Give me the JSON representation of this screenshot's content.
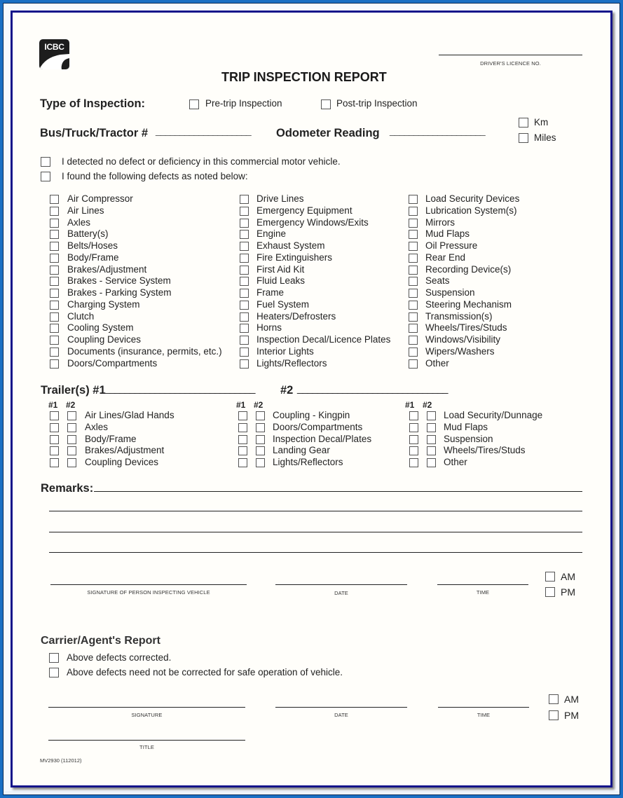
{
  "header": {
    "logo_text": "ICBC",
    "title": "TRIP INSPECTION REPORT",
    "drivers_licence_label": "DRIVER'S LICENCE NO."
  },
  "inspection_type": {
    "label": "Type of Inspection:",
    "options": [
      "Pre-trip Inspection",
      "Post-trip Inspection"
    ]
  },
  "vehicle": {
    "bus_label": "Bus/Truck/Tractor #",
    "bus_blank": "____________________",
    "odometer_label": "Odometer Reading",
    "odometer_blank": "____________________",
    "units": [
      "Km",
      "Miles"
    ]
  },
  "statements": [
    "I detected no defect or deficiency in this commercial motor vehicle.",
    "I found the following defects as noted below:"
  ],
  "defects": {
    "col1": [
      "Air Compressor",
      "Air Lines",
      "Axles",
      "Battery(s)",
      "Belts/Hoses",
      "Body/Frame",
      "Brakes/Adjustment",
      "Brakes - Service System",
      "Brakes - Parking System",
      "Charging System",
      "Clutch",
      "Cooling System",
      "Coupling Devices",
      "Documents (insurance, permits, etc.)",
      "Doors/Compartments"
    ],
    "col2": [
      "Drive Lines",
      "Emergency Equipment",
      "Emergency Windows/Exits",
      "Engine",
      "Exhaust System",
      "Fire Extinguishers",
      "First Aid Kit",
      "Fluid Leaks",
      "Frame",
      "Fuel System",
      "Heaters/Defrosters",
      "Horns",
      "Inspection Decal/Licence Plates",
      "Interior Lights",
      "Lights/Reflectors"
    ],
    "col3": [
      "Load Security Devices",
      "Lubrication System(s)",
      "Mirrors",
      "Mud Flaps",
      "Oil Pressure",
      "Rear End",
      "Recording Device(s)",
      "Seats",
      "Suspension",
      "Steering Mechanism",
      "Transmission(s)",
      "Wheels/Tires/Studs",
      "Windows/Visibility",
      "Wipers/Washers",
      "Other"
    ]
  },
  "trailers": {
    "label1": "Trailer(s) #1",
    "blank1": "______________________________",
    "label2": "#2",
    "blank2": "______________________________",
    "h1": "#1",
    "h2": "#2",
    "col1": [
      "Air Lines/Glad Hands",
      "Axles",
      "Body/Frame",
      "Brakes/Adjustment",
      "Coupling Devices"
    ],
    "col2": [
      "Coupling - Kingpin",
      "Doors/Compartments",
      "Inspection Decal/Plates",
      "Landing Gear",
      "Lights/Reflectors"
    ],
    "col3": [
      "Load Security/Dunnage",
      "Mud Flaps",
      "Suspension",
      "Wheels/Tires/Studs",
      "Other"
    ]
  },
  "remarks": {
    "label": "Remarks:",
    "signature_label": "SIGNATURE OF PERSON INSPECTING VEHICLE",
    "date_label": "DATE",
    "time_label": "TIME",
    "am": "AM",
    "pm": "PM"
  },
  "carrier": {
    "title": "Carrier/Agent's Report",
    "options": [
      "Above defects corrected.",
      "Above defects need not be corrected for safe operation of vehicle."
    ],
    "signature_label": "SIGNATURE",
    "date_label": "DATE",
    "time_label": "TIME",
    "title_label": "TITLE",
    "am": "AM",
    "pm": "PM"
  },
  "footer": {
    "form_code": "MV2930 (112012)"
  },
  "colors": {
    "frame_blue": "#1a6fc4",
    "border_navy": "#14148a",
    "ink": "#222222"
  }
}
